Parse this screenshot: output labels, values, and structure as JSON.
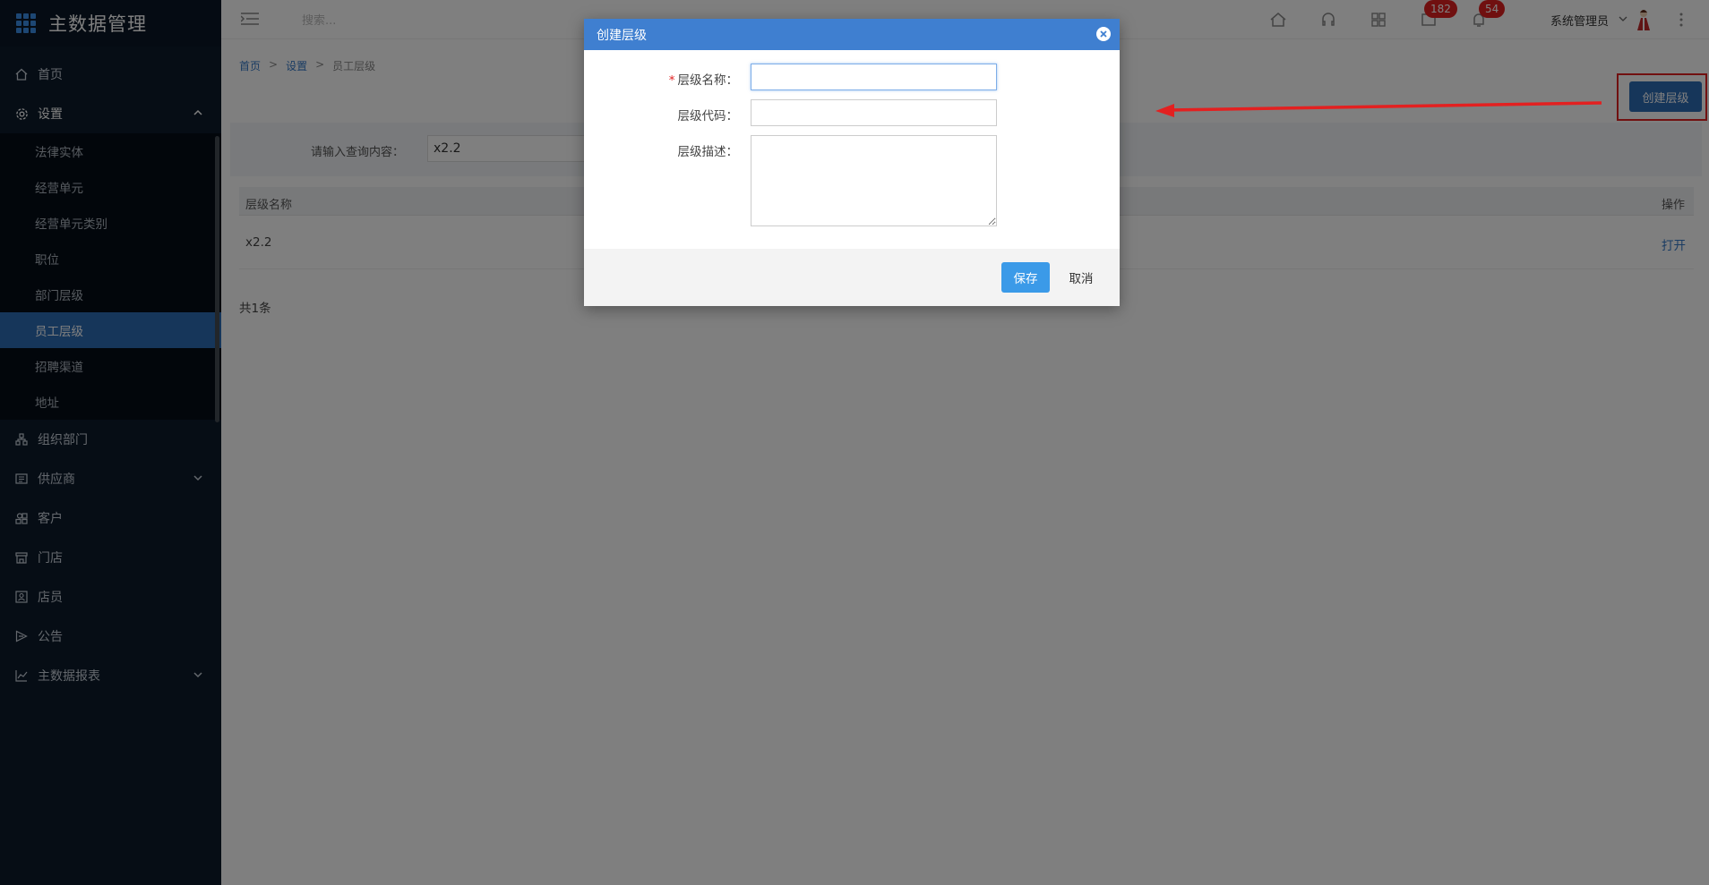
{
  "app": {
    "title": "主数据管理"
  },
  "sidebar": {
    "items": [
      {
        "label": "首页",
        "icon": "home-icon"
      },
      {
        "label": "设置",
        "icon": "gear-icon",
        "expanded": true,
        "children": [
          "法律实体",
          "经营单元",
          "经营单元类别",
          "职位",
          "部门层级",
          "员工层级",
          "招聘渠道",
          "地址"
        ],
        "active_child": "员工层级"
      },
      {
        "label": "组织部门",
        "icon": "org-tree-icon"
      },
      {
        "label": "供应商",
        "icon": "supplier-icon",
        "has_submenu": true
      },
      {
        "label": "客户",
        "icon": "customer-icon"
      },
      {
        "label": "门店",
        "icon": "store-icon"
      },
      {
        "label": "店员",
        "icon": "clerk-icon"
      },
      {
        "label": "公告",
        "icon": "announcement-icon"
      },
      {
        "label": "主数据报表",
        "icon": "chart-icon",
        "has_submenu": true
      }
    ]
  },
  "topbar": {
    "search_placeholder": "搜索...",
    "badge_messages": "182",
    "badge_notifications": "54",
    "user_name": "系统管理员"
  },
  "breadcrumb": {
    "home": "首页",
    "settings": "设置",
    "current": "员工层级",
    "separator": ">"
  },
  "page": {
    "create_button": "创建层级",
    "query_label": "请输入查询内容：",
    "query_value": "x2.2",
    "table": {
      "col_name": "层级名称",
      "col_action": "操作",
      "rows": [
        {
          "name": "x2.2",
          "action": "打开"
        }
      ]
    },
    "total": "共1条"
  },
  "modal": {
    "title": "创建层级",
    "field_name_label": "层级名称：",
    "field_name_required": "*",
    "field_name_value": "",
    "field_code_label": "层级代码：",
    "field_code_value": "",
    "field_desc_label": "层级描述：",
    "field_desc_value": "",
    "save_label": "保存",
    "cancel_label": "取消"
  },
  "colors": {
    "sidebar_bg": "#0c1a2b",
    "active_item": "#2d6cb5",
    "modal_header": "#3f7fd0",
    "save_button": "#3b9ae8",
    "annotation_red": "#e32020",
    "badge_red": "#e02020"
  }
}
